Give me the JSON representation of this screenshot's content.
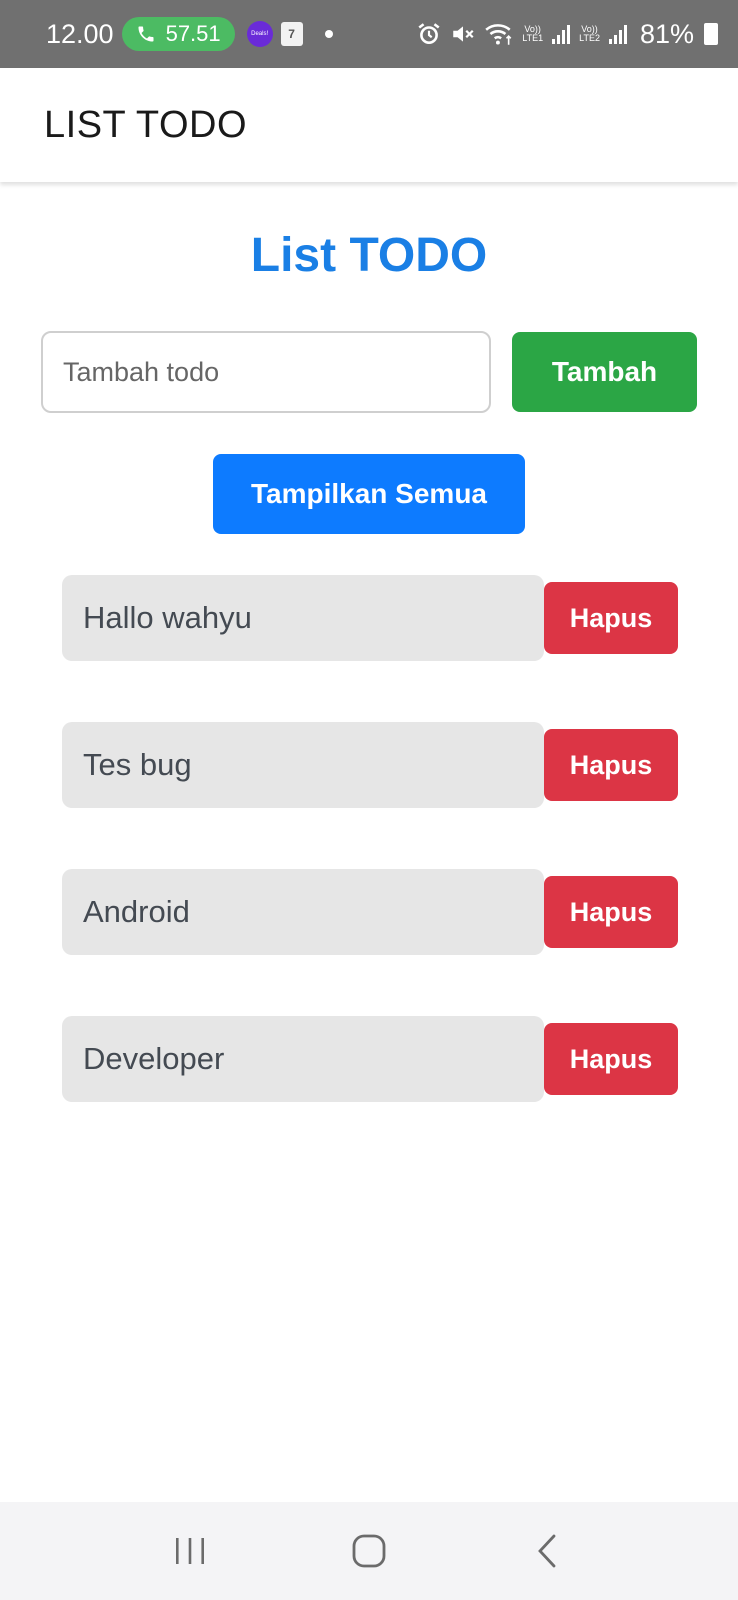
{
  "status_bar": {
    "time": "12.00",
    "call_duration": "57.51",
    "deals_label": "Deals!",
    "calendar_day": "7",
    "lte1": "LTE1",
    "lte2": "LTE2",
    "volte": "Vo))",
    "battery": "81%"
  },
  "app_bar": {
    "title": "LIST TODO"
  },
  "main": {
    "heading": "List TODO",
    "input": {
      "placeholder": "Tambah todo",
      "value": ""
    },
    "add_label": "Tambah",
    "show_all_label": "Tampilkan Semua",
    "todos": [
      {
        "text": "Hallo wahyu",
        "delete_label": "Hapus"
      },
      {
        "text": "Tes bug",
        "delete_label": "Hapus"
      },
      {
        "text": "Android",
        "delete_label": "Hapus"
      },
      {
        "text": "Developer",
        "delete_label": "Hapus"
      }
    ]
  },
  "colors": {
    "heading": "#1a7fe5",
    "add_button": "#2ba645",
    "show_all_button": "#0d7bff",
    "delete_button": "#dc3545",
    "todo_bg": "#e6e6e6"
  },
  "nav_bar": {
    "icons": [
      "recent-apps-icon",
      "home-icon",
      "back-icon"
    ]
  }
}
